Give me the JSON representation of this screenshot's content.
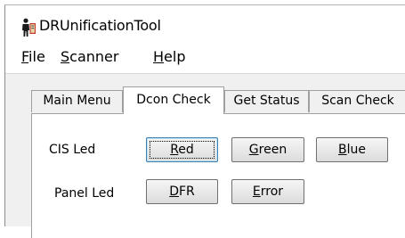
{
  "window": {
    "title": "DRUnificationTool",
    "icon": "app-figure-icon"
  },
  "menubar": {
    "items": [
      {
        "mnemonic": "F",
        "rest": "ile"
      },
      {
        "mnemonic": "S",
        "rest": "canner"
      },
      {
        "mnemonic": "H",
        "rest": "elp"
      }
    ]
  },
  "tabs": [
    {
      "label": "Main Menu",
      "active": false
    },
    {
      "label": "Dcon Check",
      "active": true
    },
    {
      "label": "Get Status",
      "active": false
    },
    {
      "label": "Scan Check",
      "active": false
    }
  ],
  "dcon_check": {
    "cis_led": {
      "label": "CIS Led",
      "buttons": [
        {
          "mnemonic": "R",
          "rest": "ed",
          "focused": true
        },
        {
          "mnemonic": "G",
          "rest": "reen",
          "focused": false
        },
        {
          "mnemonic": "B",
          "rest": "lue",
          "focused": false
        }
      ]
    },
    "panel_led": {
      "label": "Panel Led",
      "buttons": [
        {
          "mnemonic": "D",
          "rest": "FR",
          "focused": false
        },
        {
          "mnemonic": "E",
          "rest": "rror",
          "focused": false
        }
      ]
    }
  },
  "colors": {
    "window_bg": "#f0f0f0",
    "panel_bg": "#ffffff",
    "border": "#a0a0a0",
    "focus": "#3c7fb1"
  }
}
